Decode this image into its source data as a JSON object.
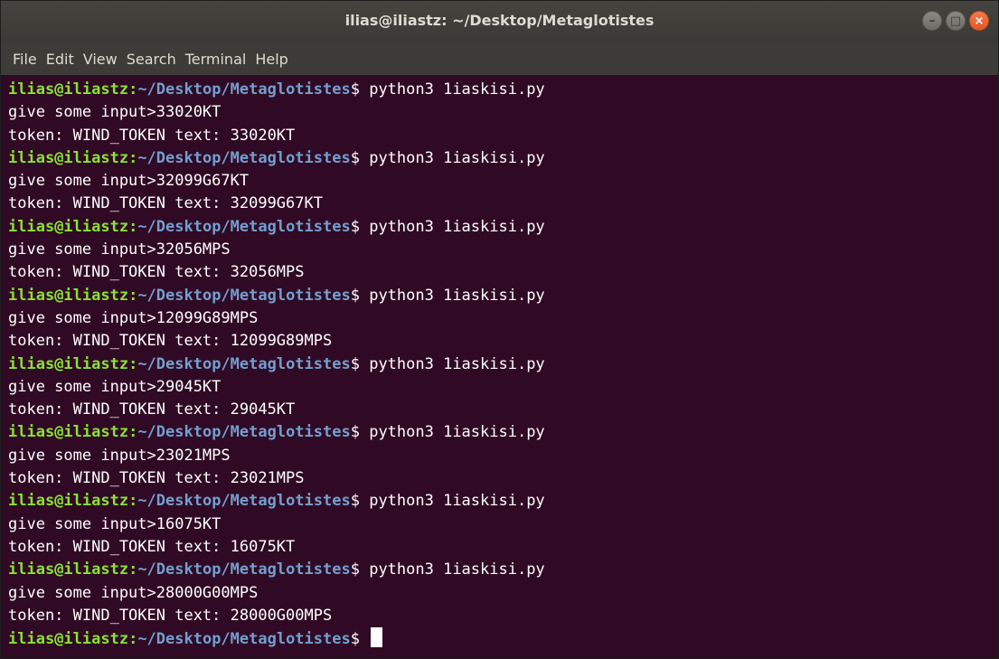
{
  "window": {
    "title": "ilias@iliastz: ~/Desktop/Metaglotistes",
    "controls": {
      "minimize": "–",
      "maximize": "□",
      "close": "×"
    }
  },
  "menu": [
    "File",
    "Edit",
    "View",
    "Search",
    "Terminal",
    "Help"
  ],
  "prompt": {
    "user_host": "ilias@iliastz",
    "colon": ":",
    "path": "~/Desktop/Metaglotistes",
    "symbol": "$ "
  },
  "sessions": [
    {
      "command": "python3 1iaskisi.py",
      "input_line": "give some input>33020KT",
      "output_line": "token: WIND_TOKEN text: 33020KT"
    },
    {
      "command": "python3 1iaskisi.py",
      "input_line": "give some input>32099G67KT",
      "output_line": "token: WIND_TOKEN text: 32099G67KT"
    },
    {
      "command": "python3 1iaskisi.py",
      "input_line": "give some input>32056MPS",
      "output_line": "token: WIND_TOKEN text: 32056MPS"
    },
    {
      "command": "python3 1iaskisi.py",
      "input_line": "give some input>12099G89MPS",
      "output_line": "token: WIND_TOKEN text: 12099G89MPS"
    },
    {
      "command": "python3 1iaskisi.py",
      "input_line": "give some input>29045KT",
      "output_line": "token: WIND_TOKEN text: 29045KT"
    },
    {
      "command": "python3 1iaskisi.py",
      "input_line": "give some input>23021MPS",
      "output_line": "token: WIND_TOKEN text: 23021MPS"
    },
    {
      "command": "python3 1iaskisi.py",
      "input_line": "give some input>16075KT",
      "output_line": "token: WIND_TOKEN text: 16075KT"
    },
    {
      "command": "python3 1iaskisi.py",
      "input_line": "give some input>28000G00MPS",
      "output_line": "token: WIND_TOKEN text: 28000G00MPS"
    }
  ],
  "colors": {
    "background": "#300a24",
    "user_host": "#8ae234",
    "path": "#729fcf",
    "text": "#ffffff"
  }
}
